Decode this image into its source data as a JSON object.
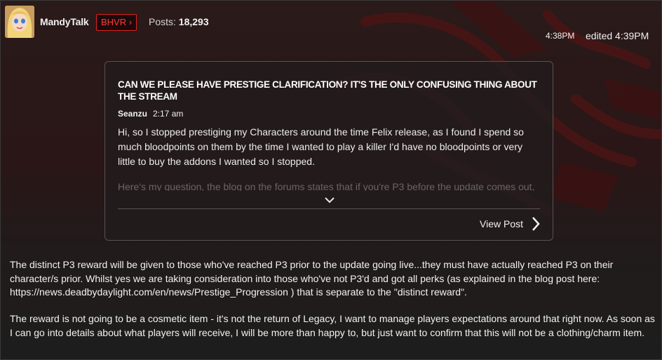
{
  "user": {
    "name": "MandyTalk",
    "badge": "BHVR ›",
    "posts_label": "Posts:",
    "posts_count": "18,293"
  },
  "meta": {
    "time": "4:38PM",
    "edited": "edited 4:39PM"
  },
  "quote": {
    "title": "CAN WE PLEASE HAVE PRESTIGE CLARIFICATION? IT'S THE ONLY CONFUSING THING ABOUT THE STREAM",
    "author": "Seanzu",
    "time": "2:17 am",
    "body": "Hi, so I stopped prestiging my Characters around the time Felix release, as I found I spend so much bloodpoints on them by the time I wanted to play a killer I'd have no bloodpoints or very little to buy the addons I wanted so I stopped.",
    "faded": "Here's my question, the blog on the forums states that if you're P3 before the update comes out,",
    "view_label": "View Post"
  },
  "body": {
    "paragraph1": "The distinct P3 reward will be given to those who've reached P3 prior to the update going live...they must have actually reached P3 on their character/s prior. Whilst yes we are taking consideration into those who've not P3'd and got all perks (as explained in the blog post here: https://news.deadbydaylight.com/en/news/Prestige_Progression ) that is separate to the \"distinct reward\".",
    "paragraph2": "The reward is not going to be a cosmetic item - it's not the return of Legacy, I want to manage players expectations around that right now. As soon as I can go into details about what players will receive, I will be more than happy to, but just want to confirm that this will not be a clothing/charm item."
  },
  "colors": {
    "badge_red": "#e02020",
    "background": "#1e1d1d",
    "art_red": "#5a1a1a"
  },
  "icons": {
    "expand": "chevron-down-icon",
    "view": "chevron-right-icon"
  }
}
